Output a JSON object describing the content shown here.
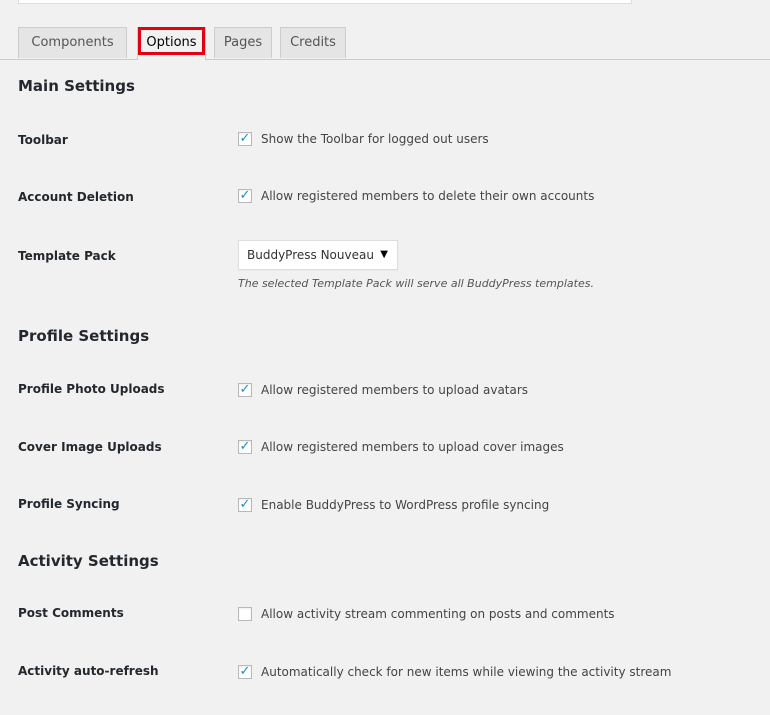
{
  "tabs": [
    {
      "label": "Components",
      "active": false
    },
    {
      "label": "Options",
      "active": true
    },
    {
      "label": "Pages",
      "active": false
    },
    {
      "label": "Credits",
      "active": false
    }
  ],
  "sections": {
    "main": "Main Settings",
    "profile": "Profile Settings",
    "activity": "Activity Settings"
  },
  "rows": {
    "toolbar": {
      "label": "Toolbar",
      "text": "Show the Toolbar for logged out users",
      "checked": true
    },
    "account_deletion": {
      "label": "Account Deletion",
      "text": "Allow registered members to delete their own accounts",
      "checked": true
    },
    "template_pack": {
      "label": "Template Pack",
      "value": "BuddyPress Nouveau",
      "description": "The selected Template Pack will serve all BuddyPress templates."
    },
    "profile_photo": {
      "label": "Profile Photo Uploads",
      "text": "Allow registered members to upload avatars",
      "checked": true
    },
    "cover_image": {
      "label": "Cover Image Uploads",
      "text": "Allow registered members to upload cover images",
      "checked": true
    },
    "profile_syncing": {
      "label": "Profile Syncing",
      "text": "Enable BuddyPress to WordPress profile syncing",
      "checked": true
    },
    "post_comments": {
      "label": "Post Comments",
      "text": "Allow activity stream commenting on posts and comments",
      "checked": false
    },
    "auto_refresh": {
      "label": "Activity auto-refresh",
      "text": "Automatically check for new items while viewing the activity stream",
      "checked": true
    }
  },
  "colors": {
    "highlight": "#e3000f",
    "checkmark": "#1e8cbe",
    "background": "#f1f1f1"
  },
  "icons": {
    "checkmark": "checkmark-icon",
    "dropdown": "dropdown-arrow-icon"
  }
}
